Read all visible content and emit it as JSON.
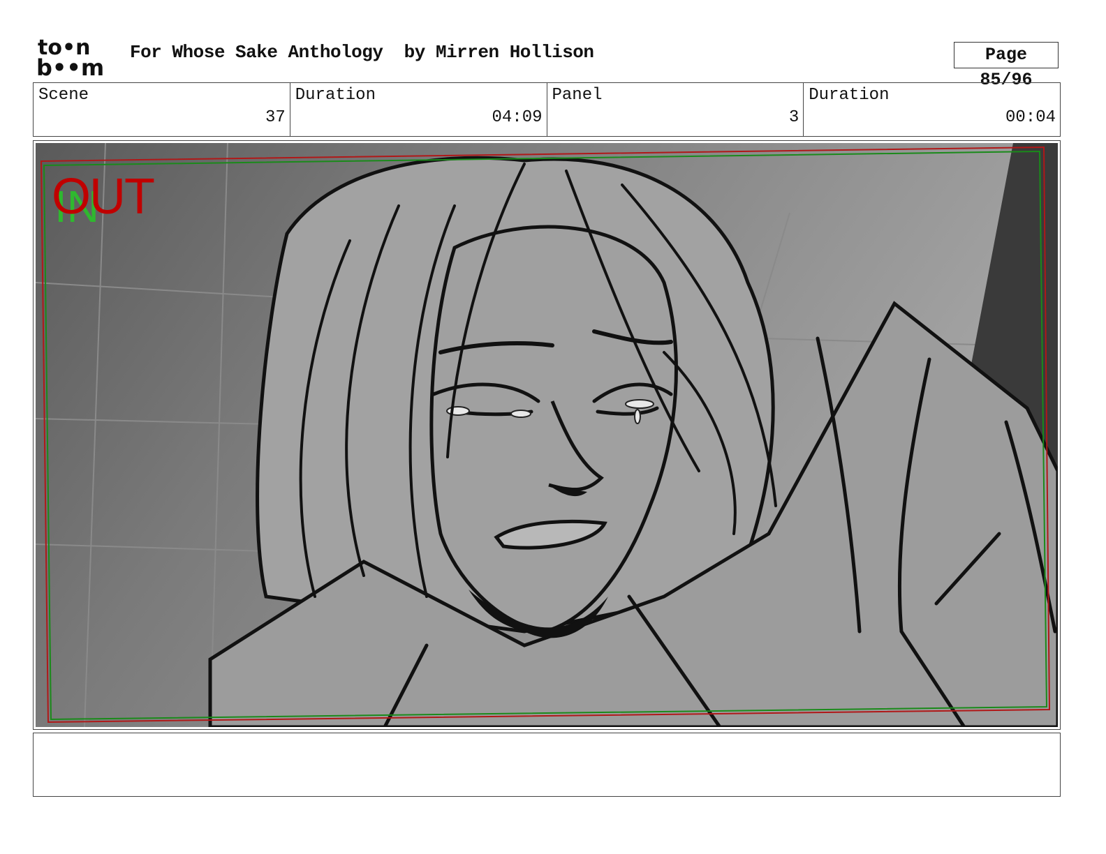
{
  "header": {
    "logo_top": "to•n",
    "logo_bottom": "b••m",
    "title": "For Whose Sake Anthology  by Mirren Hollison",
    "page": "Page 85/96"
  },
  "info": {
    "scene_label": "Scene",
    "scene_value": "37",
    "scene_duration_label": "Duration",
    "scene_duration_value": "04:09",
    "panel_label": "Panel",
    "panel_value": "3",
    "panel_duration_label": "Duration",
    "panel_duration_value": "00:04"
  },
  "panel": {
    "out_label": "OUT",
    "in_label": "IN",
    "colors": {
      "out": "#c00000",
      "in": "#2fb82f",
      "frame_red": "#b01818",
      "frame_green": "#1a8a1a"
    }
  },
  "notes": {
    "text": ""
  }
}
